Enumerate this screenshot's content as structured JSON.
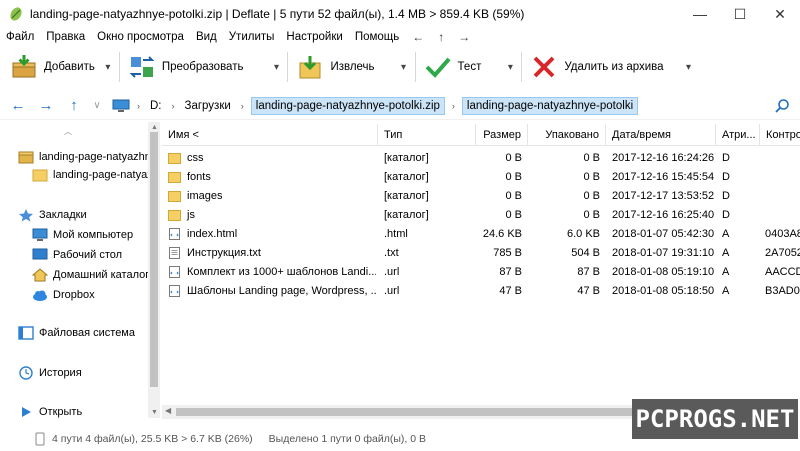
{
  "window": {
    "title": "landing-page-natyazhnye-potolki.zip | Deflate | 5 пути 52 файл(ы), 1.4 MB > 859.4 KB (59%)",
    "minimize": "—",
    "maximize": "☐",
    "close": "✕"
  },
  "menu": {
    "items": [
      "Файл",
      "Правка",
      "Окно просмотра",
      "Вид",
      "Утилиты",
      "Настройки",
      "Помощь"
    ],
    "arrows": [
      "←",
      "↑",
      "→"
    ]
  },
  "toolbar": {
    "add": "Добавить",
    "convert": "Преобразовать",
    "extract": "Извлечь",
    "test": "Тест",
    "delete": "Удалить из архива"
  },
  "address": {
    "drive": "D:",
    "crumbs": [
      "Загрузки",
      "landing-page-natyazhnye-potolki.zip",
      "landing-page-natyazhnye-potolki"
    ]
  },
  "sidebar": {
    "archive_root": "landing-page-natyazhnye-potolki.zip",
    "archive_folder": "landing-page-natyazhnye-potolki",
    "bookmarks": "Закладки",
    "my_computer": "Мой компьютер",
    "desktop": "Рабочий стол",
    "home": "Домашний каталог",
    "dropbox": "Dropbox",
    "filesystem": "Файловая система",
    "history": "История",
    "open": "Открыть"
  },
  "columns": [
    "Имя <",
    "Тип",
    "Размер",
    "Упаковано",
    "Дата/время",
    "Атри...",
    "Контро"
  ],
  "files": [
    {
      "name": "css",
      "type": "[каталог]",
      "size": "0 B",
      "packed": "0 B",
      "date": "2017-12-16 16:24:26",
      "attr": "D",
      "crc": "",
      "kind": "folder"
    },
    {
      "name": "fonts",
      "type": "[каталог]",
      "size": "0 B",
      "packed": "0 B",
      "date": "2017-12-16 15:45:54",
      "attr": "D",
      "crc": "",
      "kind": "folder"
    },
    {
      "name": "images",
      "type": "[каталог]",
      "size": "0 B",
      "packed": "0 B",
      "date": "2017-12-17 13:53:52",
      "attr": "D",
      "crc": "",
      "kind": "folder"
    },
    {
      "name": "js",
      "type": "[каталог]",
      "size": "0 B",
      "packed": "0 B",
      "date": "2017-12-16 16:25:40",
      "attr": "D",
      "crc": "",
      "kind": "folder"
    },
    {
      "name": "index.html",
      "type": ".html",
      "size": "24.6 KB",
      "packed": "6.0 KB",
      "date": "2018-01-07 05:42:30",
      "attr": "A",
      "crc": "0403A8",
      "kind": "html"
    },
    {
      "name": "Инструкция.txt",
      "type": ".txt",
      "size": "785 B",
      "packed": "504 B",
      "date": "2018-01-07 19:31:10",
      "attr": "A",
      "crc": "2A7052",
      "kind": "txt"
    },
    {
      "name": "Комплект из 1000+ шаблонов Landi...",
      "type": ".url",
      "size": "87 B",
      "packed": "87 B",
      "date": "2018-01-08 05:19:10",
      "attr": "A",
      "crc": "AACCD",
      "kind": "url"
    },
    {
      "name": "Шаблоны Landing page, Wordpress, ...",
      "type": ".url",
      "size": "47 B",
      "packed": "47 B",
      "date": "2018-01-08 05:18:50",
      "attr": "A",
      "crc": "B3AD03",
      "kind": "url"
    }
  ],
  "status": {
    "left": "4 пути 4 файл(ы), 25.5 KB > 6.7 KB (26%)",
    "right": "Выделено 1 пути 0 файл(ы), 0 B"
  },
  "watermark": "PCPROGS.NET",
  "colors": {
    "selection": "#cce4f7",
    "folder": "#f5cf63",
    "accent": "#1f6fbf"
  }
}
